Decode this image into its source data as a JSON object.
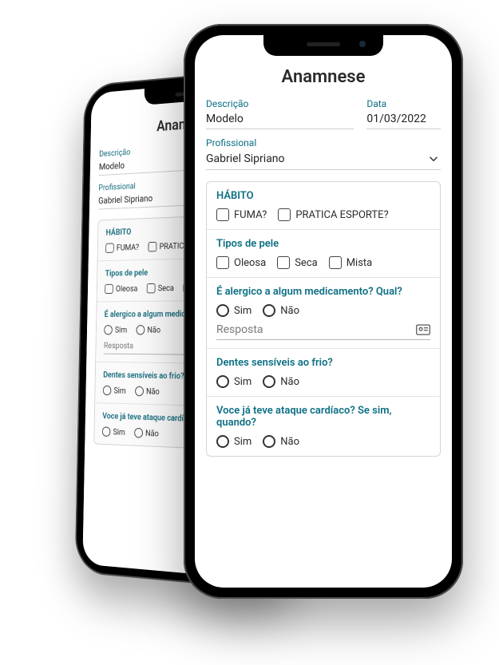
{
  "title": "Anamnese",
  "fields": {
    "descricao": {
      "label": "Descrição",
      "value": "Modelo"
    },
    "data": {
      "label": "Data",
      "value": "01/03/2022"
    },
    "profissional": {
      "label": "Profissional",
      "value": "Gabriel Sipriano"
    }
  },
  "sections": {
    "habito": {
      "title": "HÁBITO",
      "fuma": "FUMA?",
      "esporte": "PRATICA ESPORTE?"
    },
    "pele": {
      "title": "Tipos de pele",
      "oleosa": "Oleosa",
      "seca": "Seca",
      "mista": "Mista"
    },
    "alergico": {
      "title": "É alergico a algum medicamento? Qual?",
      "sim": "Sim",
      "nao": "Não",
      "resposta_placeholder": "Resposta"
    },
    "dentes": {
      "title": "Dentes sensíveis ao frio?",
      "sim": "Sim",
      "nao": "Não"
    },
    "cardiaco": {
      "title": "Voce já teve ataque cardíaco? Se sim, quando?",
      "sim": "Sim",
      "nao": "Não"
    }
  },
  "colors": {
    "accent": "#0d6f84"
  }
}
